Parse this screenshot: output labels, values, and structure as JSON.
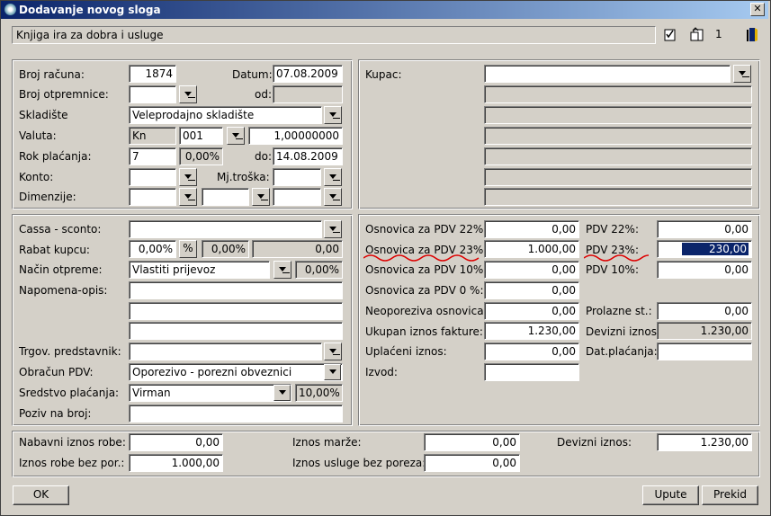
{
  "window": {
    "title": "Dodavanje novog sloga"
  },
  "toolbar": {
    "book_title": "Knjiga ira za dobra i usluge",
    "record_number": "1"
  },
  "header": {
    "broj_racuna_label": "Broj računa:",
    "broj_racuna": "1874",
    "datum_label": "Datum:",
    "datum": "07.08.2009",
    "broj_otpremnice_label": "Broj otpremnice:",
    "od_label": "od:",
    "skladiste_label": "Skladište",
    "skladiste": "Veleprodajno skladište",
    "valuta_label": "Valuta:",
    "valuta_code": "Kn",
    "valuta_num": "001",
    "valuta_tecaj": "1,00000000",
    "rok_label": "Rok plaćanja:",
    "rok_dana": "7",
    "rok_pct": "0,00%",
    "do_label": "do:",
    "rok_datum": "14.08.2009",
    "konto_label": "Konto:",
    "mj_troska_label": "Mj.troška:",
    "dimenzije_label": "Dimenzije:"
  },
  "customer": {
    "kupac_label": "Kupac:"
  },
  "details": {
    "cassa_label": "Cassa - sconto:",
    "rabat_label": "Rabat kupcu:",
    "rabat_pct": "0,00%",
    "rabat_pct_btn": "%",
    "rabat_pct2": "0,00%",
    "rabat_iznos": "0,00",
    "nacin_label": "Način otpreme:",
    "nacin": "Vlastiti prijevoz",
    "nacin_pct": "0,00%",
    "napomena_label": "Napomena-opis:",
    "trgov_label": "Trgov. predstavnik:",
    "obracun_label": "Obračun PDV:",
    "obracun": "Oporezivo - porezni obveznici",
    "sredstvo_label": "Sredstvo plaćanja:",
    "sredstvo": "Virman",
    "sredstvo_pct": "10,00%",
    "poziv_label": "Poziv na broj:"
  },
  "totals": {
    "osn22_label": "Osnovica za PDV 22%:",
    "osn22": "0,00",
    "osn23_label": "Osnovica za PDV 23%:",
    "osn23": "1.000,00",
    "osn10_label": "Osnovica za PDV 10%:",
    "osn10": "0,00",
    "osn0_label": "Osnovica za PDV 0 %:",
    "osn0": "0,00",
    "neopor_label": "Neoporeziva osnovica:",
    "neopor": "0,00",
    "ukupan_label": "Ukupan iznos fakture:",
    "ukupan": "1.230,00",
    "uplaceni_label": "Uplaćeni iznos:",
    "uplaceni": "0,00",
    "izvod_label": "Izvod:",
    "pdv22_label": "PDV 22%:",
    "pdv22": "0,00",
    "pdv23_label": "PDV 23%:",
    "pdv23": "230,00",
    "pdv10_label": "PDV 10%:",
    "pdv10": "0,00",
    "prolazne_label": "Prolazne st.:",
    "prolazne": "0,00",
    "devizni_label": "Devizni iznos:",
    "devizni": "1.230,00",
    "dat_plac_label": "Dat.plaćanja:"
  },
  "summary": {
    "nabavni_label": "Nabavni iznos robe:",
    "nabavni": "0,00",
    "robe_bez_label": "Iznos robe bez por.:",
    "robe_bez": "1.000,00",
    "marze_label": "Iznos marže:",
    "marze": "0,00",
    "usluge_label": "Iznos usluge bez poreza:",
    "usluge": "0,00",
    "devizni_label": "Devizni iznos:",
    "devizni": "1.230,00"
  },
  "buttons": {
    "ok": "OK",
    "upute": "Upute",
    "prekid": "Prekid"
  }
}
